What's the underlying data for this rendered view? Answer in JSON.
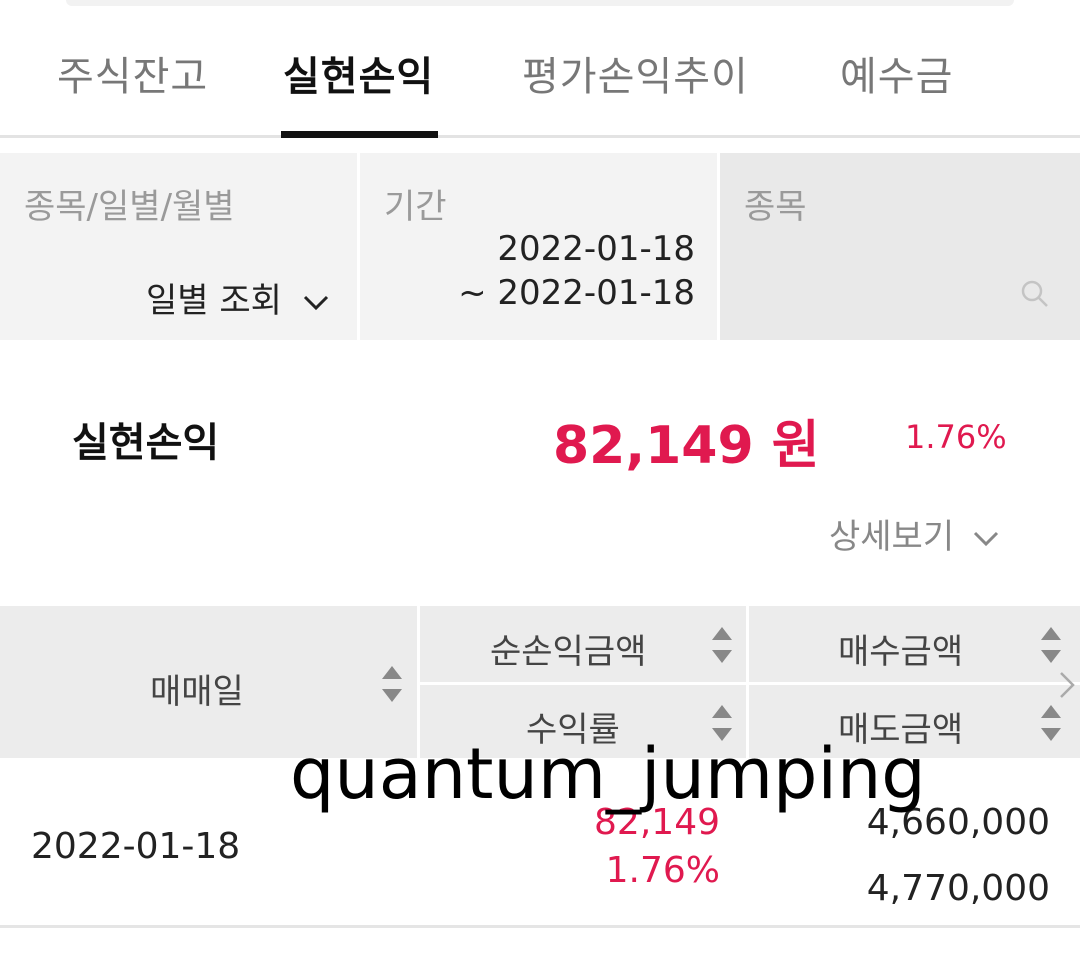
{
  "tabs": [
    {
      "label": "주식잔고"
    },
    {
      "label": "실현손익"
    },
    {
      "label": "평가손익추이"
    },
    {
      "label": "예수금"
    }
  ],
  "filters": {
    "type_label": "종목/일별/월별",
    "type_value": "일별 조회",
    "period_label": "기간",
    "period_start": "2022-01-18",
    "period_end": "~ 2022-01-18",
    "stock_label": "종목"
  },
  "summary": {
    "label": "실현손익",
    "amount": "82,149 원",
    "percent": "1.76%",
    "detail_label": "상세보기"
  },
  "table": {
    "headers": {
      "trade_date": "매매일",
      "net_profit": "순손익금액",
      "return_rate": "수익률",
      "buy_amount": "매수금액",
      "sell_amount": "매도금액"
    },
    "rows": [
      {
        "trade_date": "2022-01-18",
        "net_profit": "82,149",
        "return_rate": "1.76%",
        "buy_amount": "4,660,000",
        "sell_amount": "4,770,000"
      }
    ]
  },
  "watermark": "quantum_jumping",
  "colors": {
    "accent_red": "#e0194f",
    "tab_active": "#111111"
  }
}
